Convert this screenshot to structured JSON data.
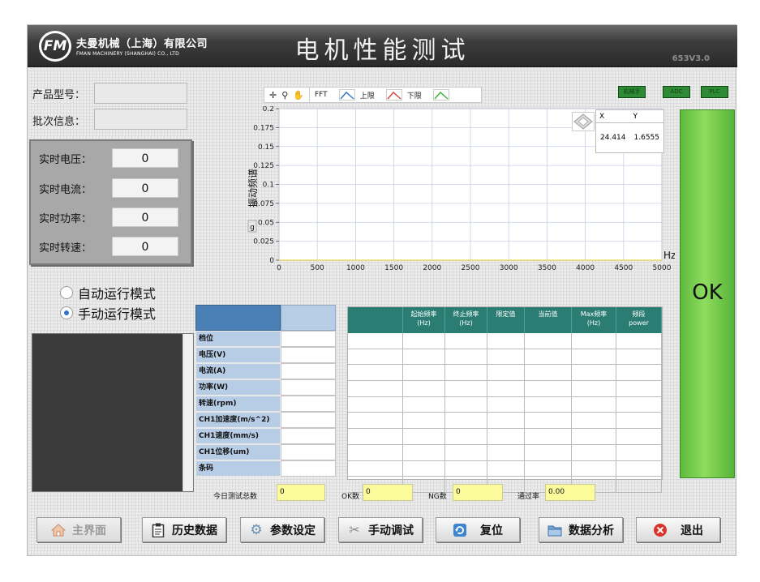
{
  "header": {
    "logo_text": "FM",
    "company_cn": "夫曼机械（上海）有限公司",
    "company_en": "FMAN MACHINERY (SHANGHAI) CO., LTD",
    "title": "电机性能测试",
    "version": "653V3.0"
  },
  "product": {
    "model_label": "产品型号：",
    "model_value": "",
    "batch_label": "批次信息：",
    "batch_value": ""
  },
  "realtime": [
    {
      "label": "实时电压：",
      "value": "0"
    },
    {
      "label": "实时电流：",
      "value": "0"
    },
    {
      "label": "实时功率：",
      "value": "0"
    },
    {
      "label": "实时转速：",
      "value": "0"
    }
  ],
  "modes": {
    "auto": "自动运行模式",
    "manual": "手动运行模式",
    "selected": "manual"
  },
  "status_leds": {
    "robot": "机械手",
    "adc": "ADC",
    "plc": "PLC",
    "color": "#2f8a35"
  },
  "plot_toolbar": {
    "fft": "FFT",
    "upper": "上限",
    "lower": "下限"
  },
  "cursor": {
    "x_header": "X",
    "y_header": "Y",
    "x_value": "24.414",
    "y_value": "1.6555"
  },
  "chart_data": {
    "type": "line",
    "ylabel": "振动频谱",
    "unit": "g",
    "xunit": "Hz",
    "xlim": [
      0,
      5000
    ],
    "ylim": [
      0,
      0.2
    ],
    "x_ticks": [
      0,
      500,
      1000,
      1500,
      2000,
      2500,
      3000,
      3500,
      4000,
      4500,
      5000
    ],
    "y_ticks": [
      "0",
      "0.025",
      "0.05",
      "0.075",
      "0.1",
      "0.125",
      "0.15",
      "0.175",
      "0.2"
    ],
    "series": [],
    "grid": true
  },
  "result": "OK",
  "left_table": {
    "rows": [
      "档位",
      "电压(V)",
      "电流(A)",
      "功率(W)",
      "转速(rpm)",
      "CH1加速度(m/s^2)",
      "CH1速度(mm/s)",
      "CH1位移(um)",
      "条码"
    ]
  },
  "right_table": {
    "headers": [
      "",
      "起始频率\n(Hz)",
      "终止频率\n(Hz)",
      "限定值",
      "当前值",
      "Max频率\n(Hz)",
      "频段\npower"
    ],
    "row_count": 10
  },
  "stats": {
    "today_label": "今日测试总数",
    "today_value": "0",
    "ok_label": "OK数",
    "ok_value": "0",
    "ng_label": "NG数",
    "ng_value": "0",
    "pass_label": "通过率",
    "pass_value": "0.00"
  },
  "buttons": {
    "home": "主界面",
    "history": "历史数据",
    "params": "参数设定",
    "manual": "手动调试",
    "reset": "复位",
    "analysis": "数据分析",
    "exit": "退出"
  }
}
